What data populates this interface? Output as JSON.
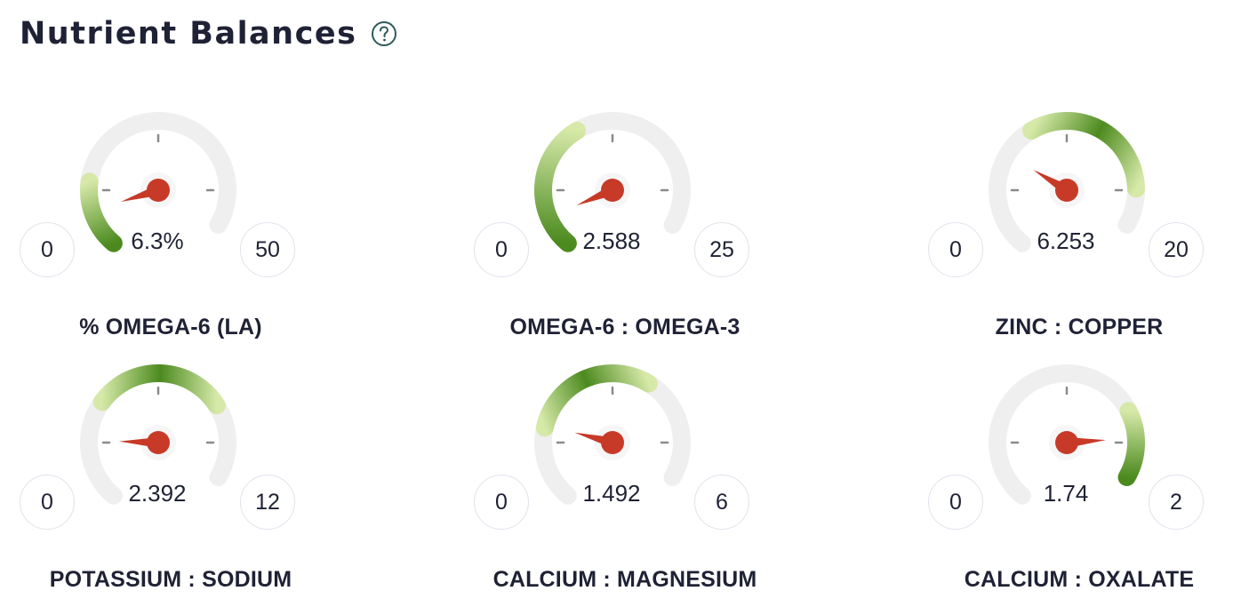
{
  "header": {
    "title": "Nutrient Balances",
    "help_icon": "question-circle-icon"
  },
  "colors": {
    "track": "#efefef",
    "green_dark": "#4c8a1f",
    "green_light": "#d6e9a8",
    "needle": "#c73a28",
    "tick": "#8a8a8a"
  },
  "gauges": [
    {
      "label": "% OMEGA-6 (LA)",
      "value_text": "6.3%",
      "min": "0",
      "max": "50",
      "value": 6.3,
      "range": [
        0,
        50
      ],
      "fill_from": 0,
      "fill_to": 0.22,
      "needle_fraction": 0.126
    },
    {
      "label": "OMEGA-6 : OMEGA-3",
      "value_text": "2.588",
      "min": "0",
      "max": "25",
      "value": 2.588,
      "range": [
        0,
        25
      ],
      "fill_from": 0,
      "fill_to": 0.42,
      "needle_fraction": 0.104
    },
    {
      "label": "ZINC : COPPER",
      "value_text": "6.253",
      "min": "0",
      "max": "20",
      "value": 6.253,
      "range": [
        0,
        20
      ],
      "fill_from": 0.42,
      "fill_to": 0.88,
      "needle_fraction": 0.313
    },
    {
      "label": "POTASSIUM : SODIUM",
      "value_text": "2.392",
      "min": "0",
      "max": "12",
      "value": 2.392,
      "range": [
        0,
        12
      ],
      "fill_from": 0.33,
      "fill_to": 0.76,
      "needle_fraction": 0.199
    },
    {
      "label": "CALCIUM : MAGNESIUM",
      "value_text": "1.492",
      "min": "0",
      "max": "6",
      "value": 1.492,
      "range": [
        0,
        6
      ],
      "fill_from": 0.24,
      "fill_to": 0.66,
      "needle_fraction": 0.249
    },
    {
      "label": "CALCIUM : OXALATE",
      "value_text": "1.74",
      "min": "0",
      "max": "2",
      "value": 1.74,
      "range": [
        0,
        2
      ],
      "fill_from": 0.78,
      "fill_to": 1.0,
      "needle_fraction": 0.87
    }
  ]
}
